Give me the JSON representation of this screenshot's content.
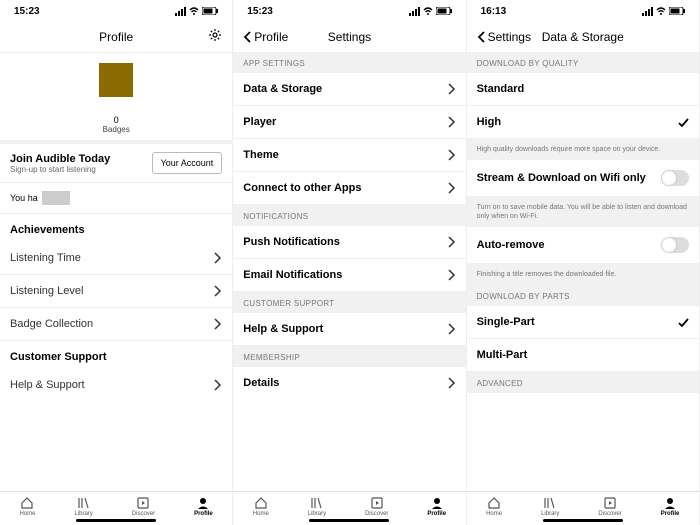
{
  "status": {
    "time1": "15:23",
    "time2": "15:23",
    "time3": "16:13"
  },
  "p1": {
    "title": "Profile",
    "badges_count": "0",
    "badges_label": "Badges",
    "join_title": "Join Audible Today",
    "join_sub": "Sign-up to start listening",
    "account_btn": "Your Account",
    "you_prefix": "You ha",
    "achievements": "Achievements",
    "rows": {
      "listening_time": "Listening Time",
      "listening_level": "Listening Level",
      "badge_collection": "Badge Collection"
    },
    "cust_support": "Customer Support",
    "help": "Help & Support"
  },
  "p2": {
    "back": "Profile",
    "title": "Settings",
    "sec_app": "APP SETTINGS",
    "rows": {
      "data_storage": "Data & Storage",
      "player": "Player",
      "theme": "Theme",
      "connect": "Connect to other Apps"
    },
    "sec_notif": "NOTIFICATIONS",
    "push": "Push Notifications",
    "email": "Email Notifications",
    "sec_support": "CUSTOMER SUPPORT",
    "help": "Help & Support",
    "sec_member": "MEMBERSHIP",
    "details": "Details"
  },
  "p3": {
    "back": "Settings",
    "title": "Data & Storage",
    "sec_quality": "DOWNLOAD BY QUALITY",
    "standard": "Standard",
    "high": "High",
    "quality_hint": "High quality downloads require more space on your device.",
    "wifi": "Stream & Download on Wifi only",
    "wifi_hint": "Turn on to save mobile data. You will be able to listen and download only when on Wi-Fi.",
    "auto_remove": "Auto-remove",
    "auto_hint": "Finishing a title removes the downloaded file.",
    "sec_parts": "DOWNLOAD BY PARTS",
    "single": "Single-Part",
    "multi": "Multi-Part",
    "sec_advanced": "ADVANCED"
  },
  "tabs": {
    "home": "Home",
    "library": "Library",
    "discover": "Discover",
    "profile": "Profile"
  }
}
